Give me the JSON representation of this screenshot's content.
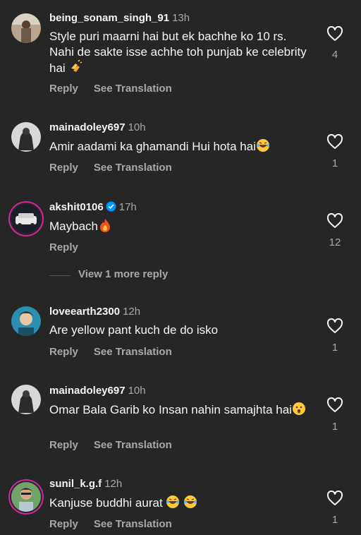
{
  "comments": [
    {
      "username": "being_sonam_singh_91",
      "time": "13h",
      "text_main": "Style puri maarni hai but ek bachhe ko 10 rs. Nahi de sakte  isse achhe toh punjab ke celebrity hai",
      "emoji": "clapping-hands",
      "reply": "Reply",
      "translate": "See Translation",
      "likes": "4"
    },
    {
      "username": "mainadoley697",
      "time": "10h",
      "text_main": "Amir aadami ka ghamandi Hui hota hai",
      "emoji": "laughing-face",
      "reply": "Reply",
      "translate": "See Translation",
      "likes": "1"
    },
    {
      "username": "akshit0106",
      "time": "17h",
      "text_main": "Maybach",
      "emoji": "fire",
      "reply": "Reply",
      "likes": "12"
    },
    {
      "username": "loveearth2300",
      "time": "12h",
      "text_main": "Are yellow pant kuch de do isko",
      "reply": "Reply",
      "translate": "See Translation",
      "likes": "1"
    },
    {
      "username": "mainadoley697",
      "time": "10h",
      "text_main": "Omar Bala Garib ko Insan nahin samajhta hai",
      "emoji": "surprised-face",
      "reply": "Reply",
      "translate": "See Translation",
      "likes": "1"
    },
    {
      "username": "sunil_k.g.f",
      "time": "12h",
      "text_main": "Kanjuse buddhi aurat",
      "emoji": "laughing-face",
      "reply": "Reply",
      "translate": "See Translation",
      "likes": "1"
    }
  ],
  "view_more": "View 1 more reply",
  "colors": {
    "background": "#262626",
    "primary_text": "#f5f5f5",
    "secondary_text": "#a8a8a8",
    "verified": "#0095f6"
  }
}
